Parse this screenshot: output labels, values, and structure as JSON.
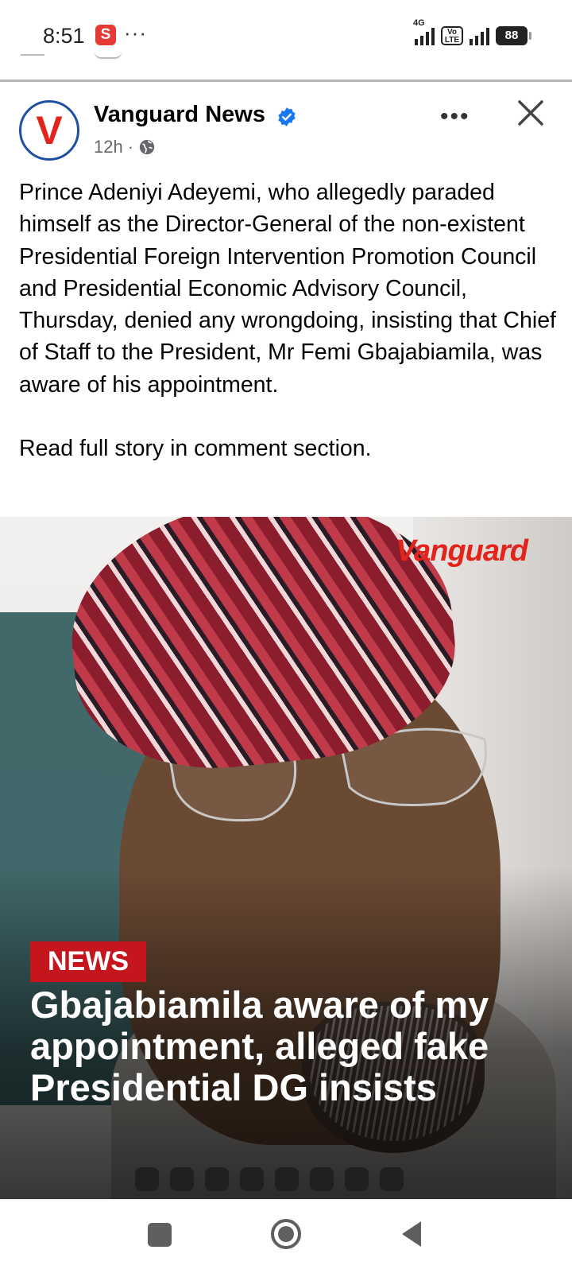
{
  "status_bar": {
    "time": "8:51",
    "notification_badge": "S",
    "overflow": "···",
    "network_type": "4G",
    "volte_label": "Vo LTE",
    "battery": "88"
  },
  "post": {
    "page_name": "Vanguard News",
    "avatar_letter": "V",
    "time_ago": "12h",
    "separator": "·",
    "more_label": "•••",
    "caption": "Prince Adeniyi Adeyemi, who allegedly paraded himself as the Director-General of the non-existent Presidential Foreign Intervention Promotion Council and Presidential Economic Advisory Council, Thursday, denied any wrongdoing, insisting that Chief of Staff to the President, Mr Femi Gbajabiamila, was aware of his appointment.\n\nRead full story in comment section.",
    "image": {
      "brand": "Vanguard",
      "tag": "NEWS",
      "headline": "Gbajabiamila aware of my appointment, alleged fake Presidential DG insists"
    }
  },
  "icons": {
    "verified": "verified-badge-icon",
    "globe": "globe-icon",
    "close": "close-icon",
    "more": "more-options-icon"
  },
  "colors": {
    "brand_red": "#e3241b",
    "verified_blue": "#1877f2",
    "tag_red": "#c4161c"
  }
}
